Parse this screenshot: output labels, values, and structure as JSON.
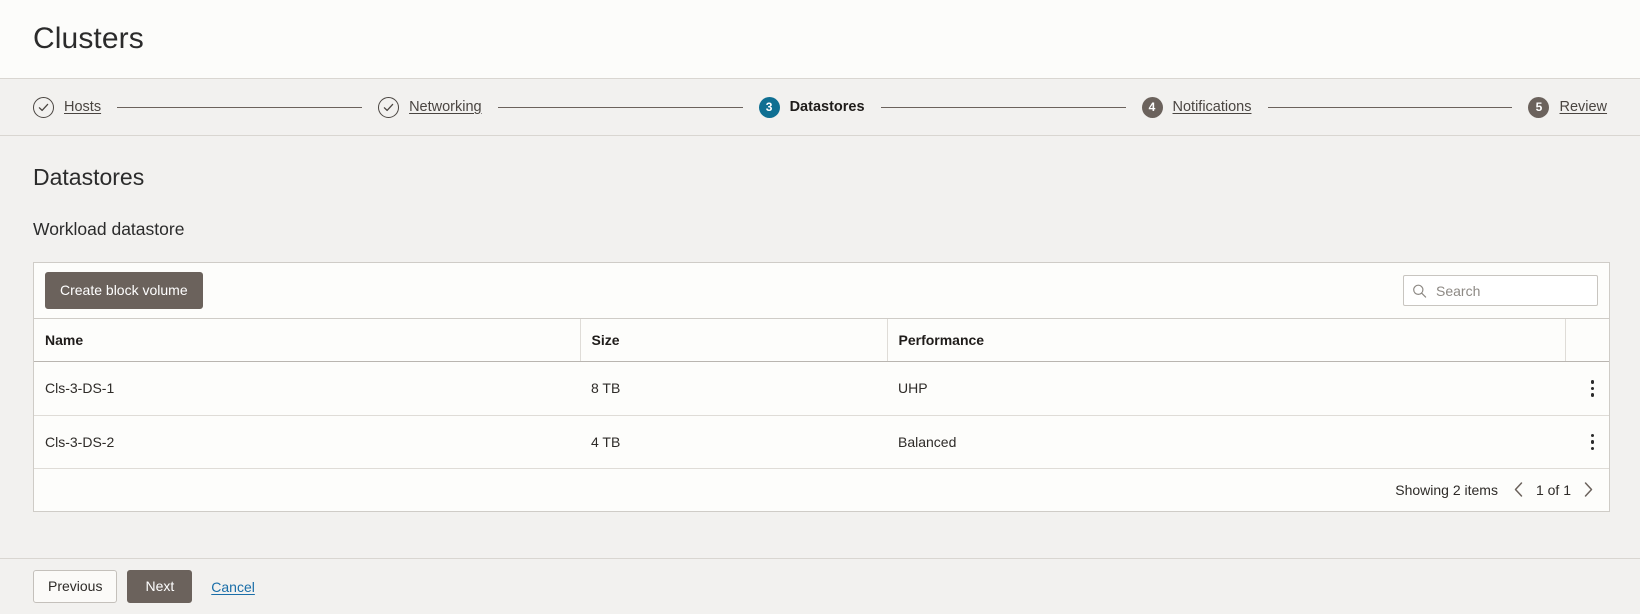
{
  "header": {
    "title": "Clusters"
  },
  "stepper": {
    "steps": [
      {
        "number": "1",
        "label": "Hosts",
        "state": "done",
        "icon": "check-icon"
      },
      {
        "number": "2",
        "label": "Networking",
        "state": "done",
        "icon": "check-icon"
      },
      {
        "number": "3",
        "label": "Datastores",
        "state": "current",
        "icon": ""
      },
      {
        "number": "4",
        "label": "Notifications",
        "state": "todo",
        "icon": ""
      },
      {
        "number": "5",
        "label": "Review",
        "state": "todo",
        "icon": ""
      }
    ]
  },
  "main": {
    "section_title": "Datastores",
    "subsection_title": "Workload datastore"
  },
  "toolbar": {
    "create_label": "Create block volume",
    "search_placeholder": "Search",
    "search_value": "",
    "search_icon": "search-icon"
  },
  "table": {
    "columns": [
      "Name",
      "Size",
      "Performance"
    ],
    "rows": [
      {
        "name": "Cls-3-DS-1",
        "size": "8 TB",
        "performance": "UHP",
        "actions_icon": "kebab-menu-icon"
      },
      {
        "name": "Cls-3-DS-2",
        "size": "4 TB",
        "performance": "Balanced",
        "actions_icon": "kebab-menu-icon"
      }
    ]
  },
  "footer": {
    "showing_text": "Showing 2 items",
    "page_label": "1 of 1",
    "prev_page_icon": "chevron-left-icon",
    "next_page_icon": "chevron-right-icon"
  },
  "actions": {
    "previous_label": "Previous",
    "next_label": "Next",
    "cancel_label": "Cancel"
  },
  "colors": {
    "accent": "#0f6f92",
    "button": "#6b625c",
    "link": "#1a6ea8",
    "page_bg": "#f2f1ef",
    "panel_bg": "#fdfdfb"
  }
}
